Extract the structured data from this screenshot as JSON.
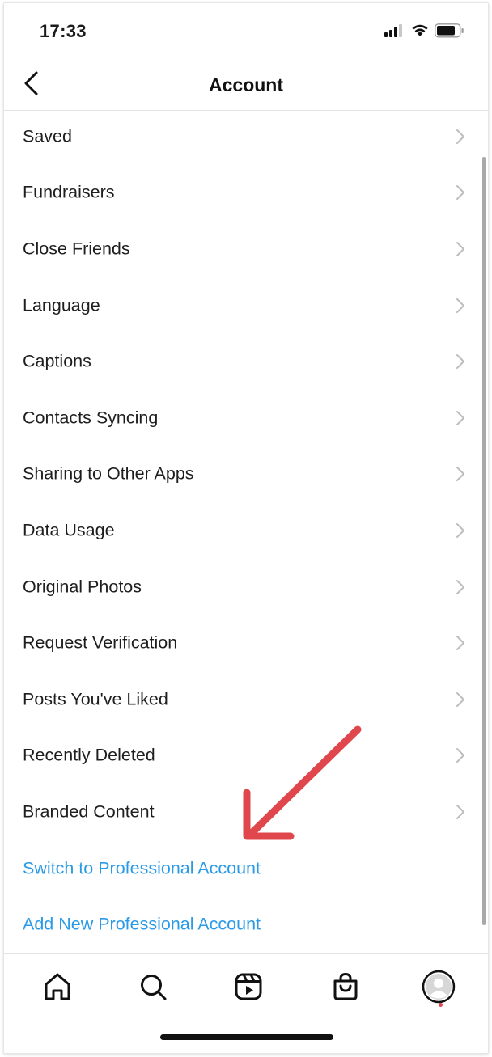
{
  "status_bar": {
    "time": "17:33"
  },
  "header": {
    "title": "Account"
  },
  "menu": {
    "items": [
      {
        "label": "Saved"
      },
      {
        "label": "Fundraisers"
      },
      {
        "label": "Close Friends"
      },
      {
        "label": "Language"
      },
      {
        "label": "Captions"
      },
      {
        "label": "Contacts Syncing"
      },
      {
        "label": "Sharing to Other Apps"
      },
      {
        "label": "Data Usage"
      },
      {
        "label": "Original Photos"
      },
      {
        "label": "Request Verification"
      },
      {
        "label": "Posts You've Liked"
      },
      {
        "label": "Recently Deleted"
      },
      {
        "label": "Branded Content"
      }
    ],
    "links": [
      {
        "label": "Switch to Professional Account"
      },
      {
        "label": "Add New Professional Account"
      }
    ]
  },
  "tab_bar": {
    "tabs": [
      {
        "icon": "home-icon"
      },
      {
        "icon": "search-icon"
      },
      {
        "icon": "reels-icon"
      },
      {
        "icon": "shop-icon"
      },
      {
        "icon": "profile-avatar"
      }
    ]
  },
  "colors": {
    "link": "#2a9ae6",
    "annotation_arrow": "#e0474c",
    "notification_dot": "#e0474c"
  }
}
